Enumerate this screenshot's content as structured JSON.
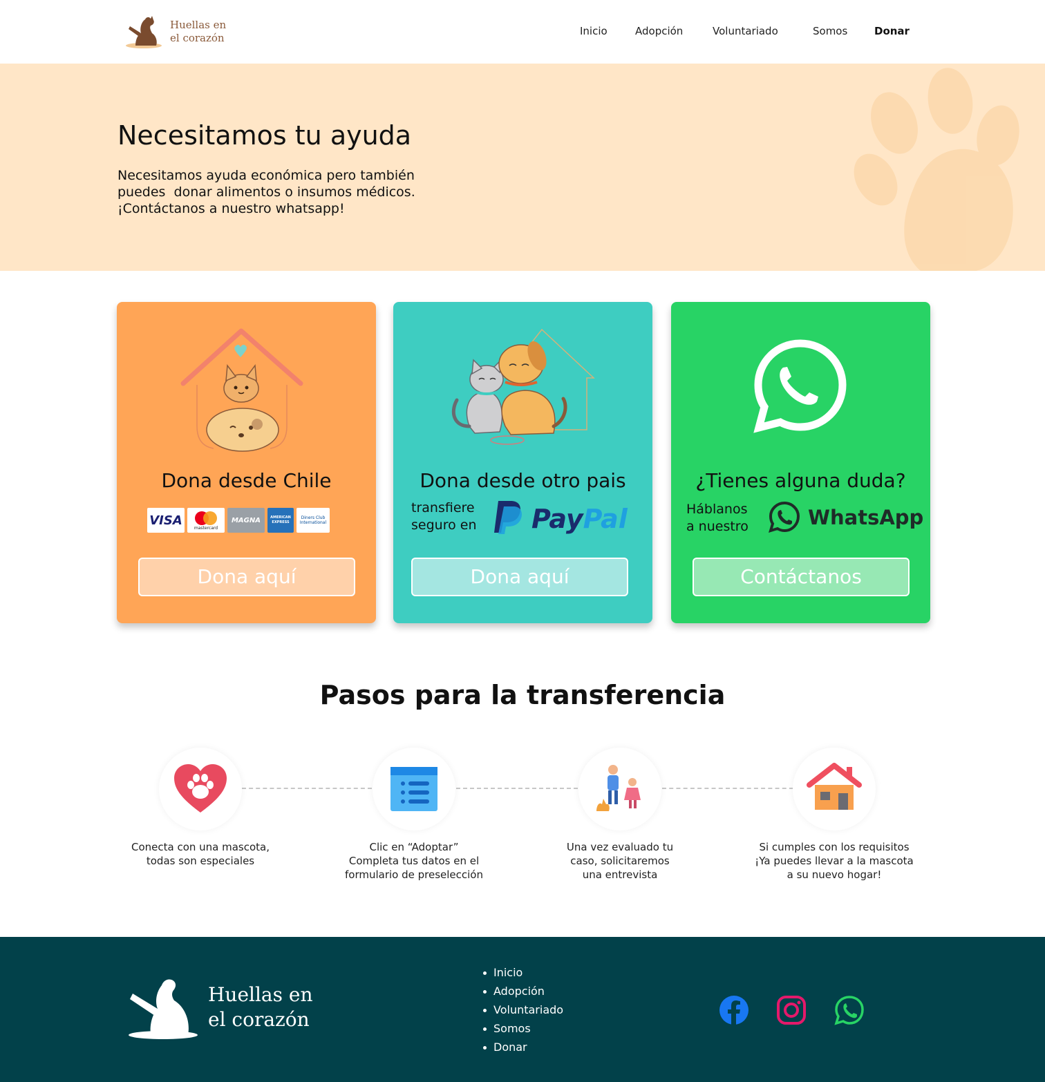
{
  "nav": {
    "brand_line1": "Huellas en",
    "brand_line2": "el corazón",
    "links": [
      "Inicio",
      "Adopción",
      "Voluntariado",
      "Somos",
      "Donar"
    ],
    "active": "Donar"
  },
  "hero": {
    "title": "Necesitamos tu ayuda",
    "text_lines": [
      "Necesitamos ayuda económica pero también",
      "puedes  donar alimentos o insumos médicos.",
      "¡Contáctanos a nuestro whatsapp!"
    ]
  },
  "cards": {
    "chile": {
      "title": "Dona desde Chile",
      "payment_logos": [
        "VISA",
        "mastercard",
        "MAGNA",
        "AMERICAN EXPRESS",
        "Diners Club International"
      ],
      "button": "Dona aquí",
      "color": "#ffa556"
    },
    "abroad": {
      "title": "Dona desde otro pais",
      "sub_line1": "transfiere",
      "sub_line2": "seguro en",
      "brand_pay": "Pay",
      "brand_pal": "Pal",
      "button": "Dona aquí",
      "color": "#3ecdc1"
    },
    "contact": {
      "title": "¿Tienes alguna duda?",
      "sub_line1": "Háblanos",
      "sub_line2": "a nuestro",
      "brand": "WhatsApp",
      "button": "Contáctanos",
      "color": "#28d365"
    }
  },
  "steps": {
    "title": "Pasos para la transferencia",
    "items": [
      {
        "icon": "heart-paw-icon",
        "lines": [
          "Conecta con una mascota,",
          "todas son especiales"
        ]
      },
      {
        "icon": "form-list-icon",
        "lines": [
          "Clic en “Adoptar”",
          "Completa tus datos en el",
          "formulario de preselección"
        ]
      },
      {
        "icon": "family-interview-icon",
        "lines": [
          "Una vez evaluado tu",
          "caso, solicitaremos",
          "una entrevista"
        ]
      },
      {
        "icon": "house-icon",
        "lines": [
          "Si cumples con los requisitos",
          "¡Ya puedes llevar a la mascota",
          "a su nuevo hogar!"
        ]
      }
    ]
  },
  "footer": {
    "brand_line1": "Huellas en",
    "brand_line2": "el corazón",
    "links": [
      "Inicio",
      "Adopción",
      "Voluntariado",
      "Somos",
      "Donar"
    ],
    "social": [
      "facebook-icon",
      "instagram-icon",
      "whatsapp-icon"
    ],
    "background": "#02414a"
  }
}
